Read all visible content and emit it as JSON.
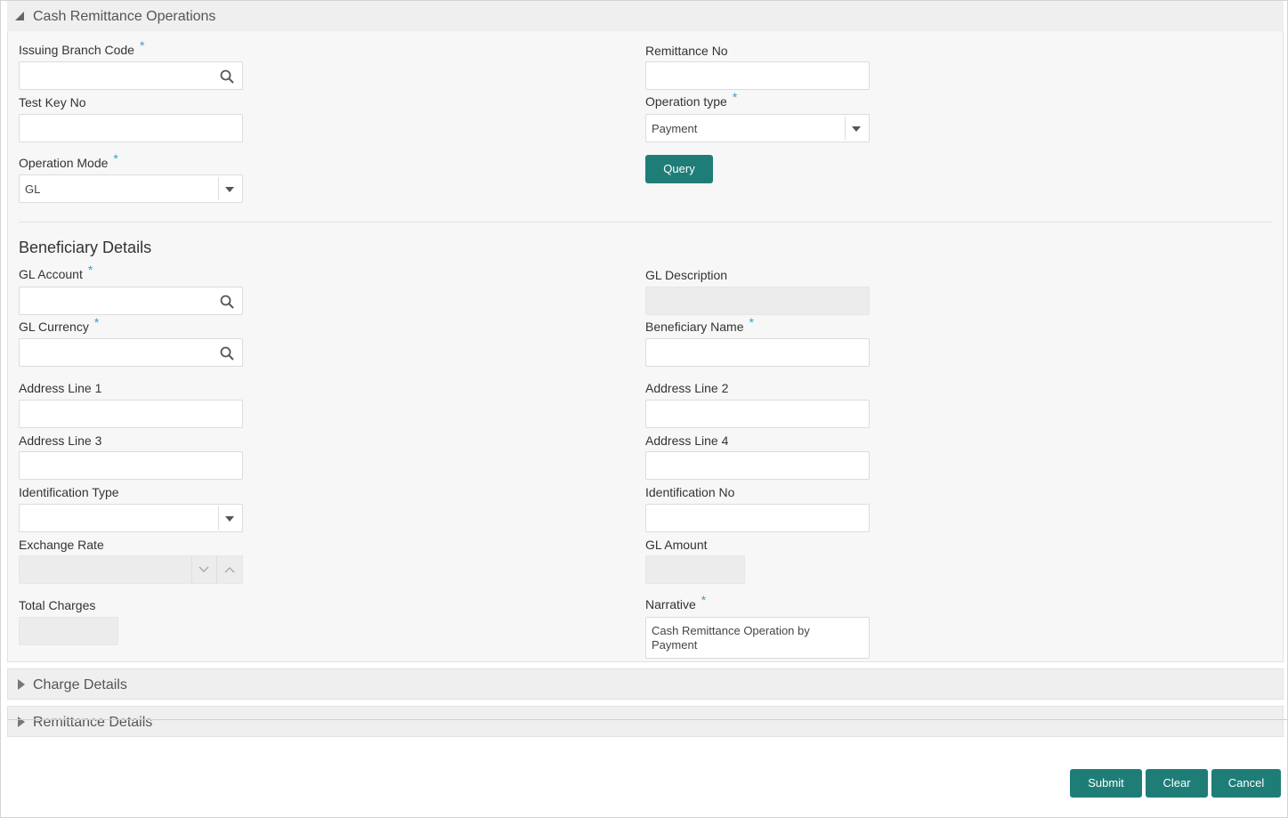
{
  "title": "Cash Remittance Operations",
  "form": {
    "issuing_branch_code": {
      "label": "Issuing Branch Code",
      "required": "*",
      "value": ""
    },
    "remittance_no": {
      "label": "Remittance No",
      "value": ""
    },
    "test_key_no": {
      "label": "Test Key No",
      "value": ""
    },
    "operation_type": {
      "label": "Operation type",
      "required": "*",
      "value": "Payment"
    },
    "operation_mode": {
      "label": "Operation Mode",
      "required": "*",
      "value": "GL"
    },
    "query_button": "Query"
  },
  "beneficiary": {
    "heading": "Beneficiary Details",
    "gl_account": {
      "label": "GL Account",
      "required": "*",
      "value": ""
    },
    "gl_description": {
      "label": "GL Description",
      "value": ""
    },
    "gl_currency": {
      "label": "GL Currency",
      "required": "*",
      "value": ""
    },
    "beneficiary_name": {
      "label": "Beneficiary Name",
      "required": "*",
      "value": ""
    },
    "address_line_1": {
      "label": "Address Line 1",
      "value": ""
    },
    "address_line_2": {
      "label": "Address Line 2",
      "value": ""
    },
    "address_line_3": {
      "label": "Address Line 3",
      "value": ""
    },
    "address_line_4": {
      "label": "Address Line 4",
      "value": ""
    },
    "identification_type": {
      "label": "Identification Type",
      "value": ""
    },
    "identification_no": {
      "label": "Identification No",
      "value": ""
    },
    "exchange_rate": {
      "label": "Exchange Rate",
      "value": ""
    },
    "gl_amount": {
      "label": "GL Amount",
      "value": ""
    },
    "total_charges": {
      "label": "Total Charges",
      "value": ""
    },
    "narrative": {
      "label": "Narrative",
      "required": "*",
      "value_line1": "Cash Remittance Operation by",
      "value_line2": "Payment"
    }
  },
  "sections": {
    "charge_details": "Charge Details",
    "remittance_details": "Remittance Details"
  },
  "footer": {
    "submit": "Submit",
    "clear": "Clear",
    "cancel": "Cancel"
  },
  "colors": {
    "accent": "#1f7d78",
    "required": "#3aa0c7",
    "panel": "#f7f7f7"
  }
}
